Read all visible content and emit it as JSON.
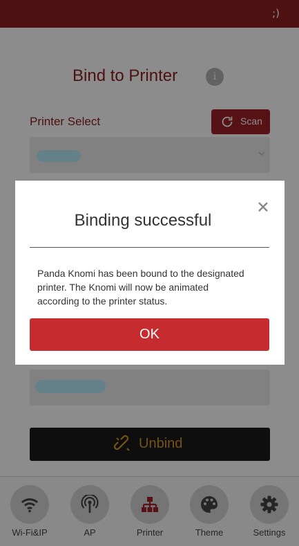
{
  "topbar": {
    "right_text": ";)"
  },
  "header": {
    "title": "Bind to Printer",
    "info_icon": "info-icon"
  },
  "printer_select": {
    "label": "Printer Select",
    "scan_label": "Scan",
    "scan_icon": "refresh-icon",
    "chevron_icon": "chevron-down-icon"
  },
  "unbind": {
    "label": "Unbind",
    "icon": "link-icon"
  },
  "colors": {
    "brand": "#8e1f22",
    "ok_button": "#c62b2f",
    "unbind_text": "#d9962d",
    "redacted_pill": "#b7ecfb"
  },
  "nav": {
    "items": [
      {
        "label": "Wi-Fi&IP",
        "icon": "wifi-icon"
      },
      {
        "label": "AP",
        "icon": "antenna-icon"
      },
      {
        "label": "Printer",
        "icon": "network-icon"
      },
      {
        "label": "Theme",
        "icon": "palette-icon"
      },
      {
        "label": "Settings",
        "icon": "gear-icon"
      }
    ]
  },
  "dialog": {
    "title": "Binding successful",
    "message": "Panda Knomi has been bound to the designated printer. The Knomi will now be animated according to the printer status.",
    "ok_label": "OK",
    "close_icon": "close-icon"
  }
}
